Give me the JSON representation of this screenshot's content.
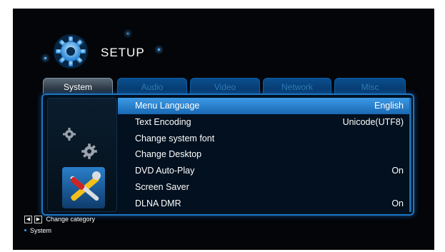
{
  "header": {
    "title": "SETUP",
    "icon": "gear-icon"
  },
  "tabs": [
    {
      "label": "System",
      "active": true
    },
    {
      "label": "Audio",
      "active": false
    },
    {
      "label": "Video",
      "active": false
    },
    {
      "label": "Network",
      "active": false
    },
    {
      "label": "Misc",
      "active": false
    }
  ],
  "menu": {
    "items": [
      {
        "label": "Menu Language",
        "value": "English",
        "selected": true
      },
      {
        "label": "Text Encoding",
        "value": "Unicode(UTF8)"
      },
      {
        "label": "Change system font",
        "value": ""
      },
      {
        "label": "Change Desktop",
        "value": ""
      },
      {
        "label": "DVD Auto-Play",
        "value": "On"
      },
      {
        "label": "Screen Saver",
        "value": ""
      },
      {
        "label": "DLNA DMR",
        "value": "On"
      }
    ]
  },
  "footer": {
    "hint": "Change category",
    "section": "System"
  },
  "colors": {
    "accent": "#1c76c2",
    "selected": "#2d84d3",
    "background": "#030508"
  }
}
